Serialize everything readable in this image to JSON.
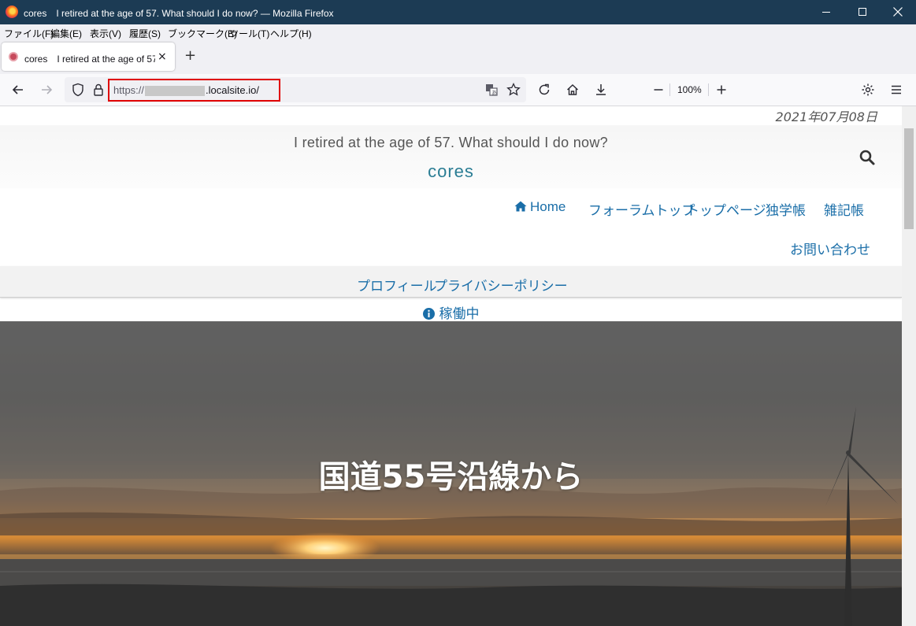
{
  "window": {
    "title": "cores　I retired at the age of 57. What should I do now? — Mozilla Firefox"
  },
  "menu": [
    "ファイル(F)",
    "編集(E)",
    "表示(V)",
    "履歴(S)",
    "ブックマーク(B)",
    "ツール(T)",
    "ヘルプ(H)"
  ],
  "tab": {
    "title": "cores　I retired at the age of 57. What should I do now?",
    "close": "×"
  },
  "newtab": "+",
  "address": {
    "scheme": "https://",
    "host": ".localsite.io/"
  },
  "zoom": "100%",
  "page": {
    "date": "2021年07月08日",
    "tagline": "I retired at the age of 57. What should I do now?",
    "sitename": "cores",
    "nav": {
      "home": "Home",
      "forum": "フォーラムトップ",
      "top": "トップページ",
      "study": "独学帳",
      "notes": "雑記帳",
      "contact": "お問い合わせ"
    },
    "subnav": {
      "profile": "プロフィール",
      "privacy": "プライバシーポリシー"
    },
    "status": "稼働中",
    "hero_title": "国道55号沿線から"
  },
  "colors": {
    "titlebar": "#1c3b54",
    "link": "#1a6ea8",
    "sitename": "#2a7d94",
    "url_highlight": "#e00000"
  }
}
